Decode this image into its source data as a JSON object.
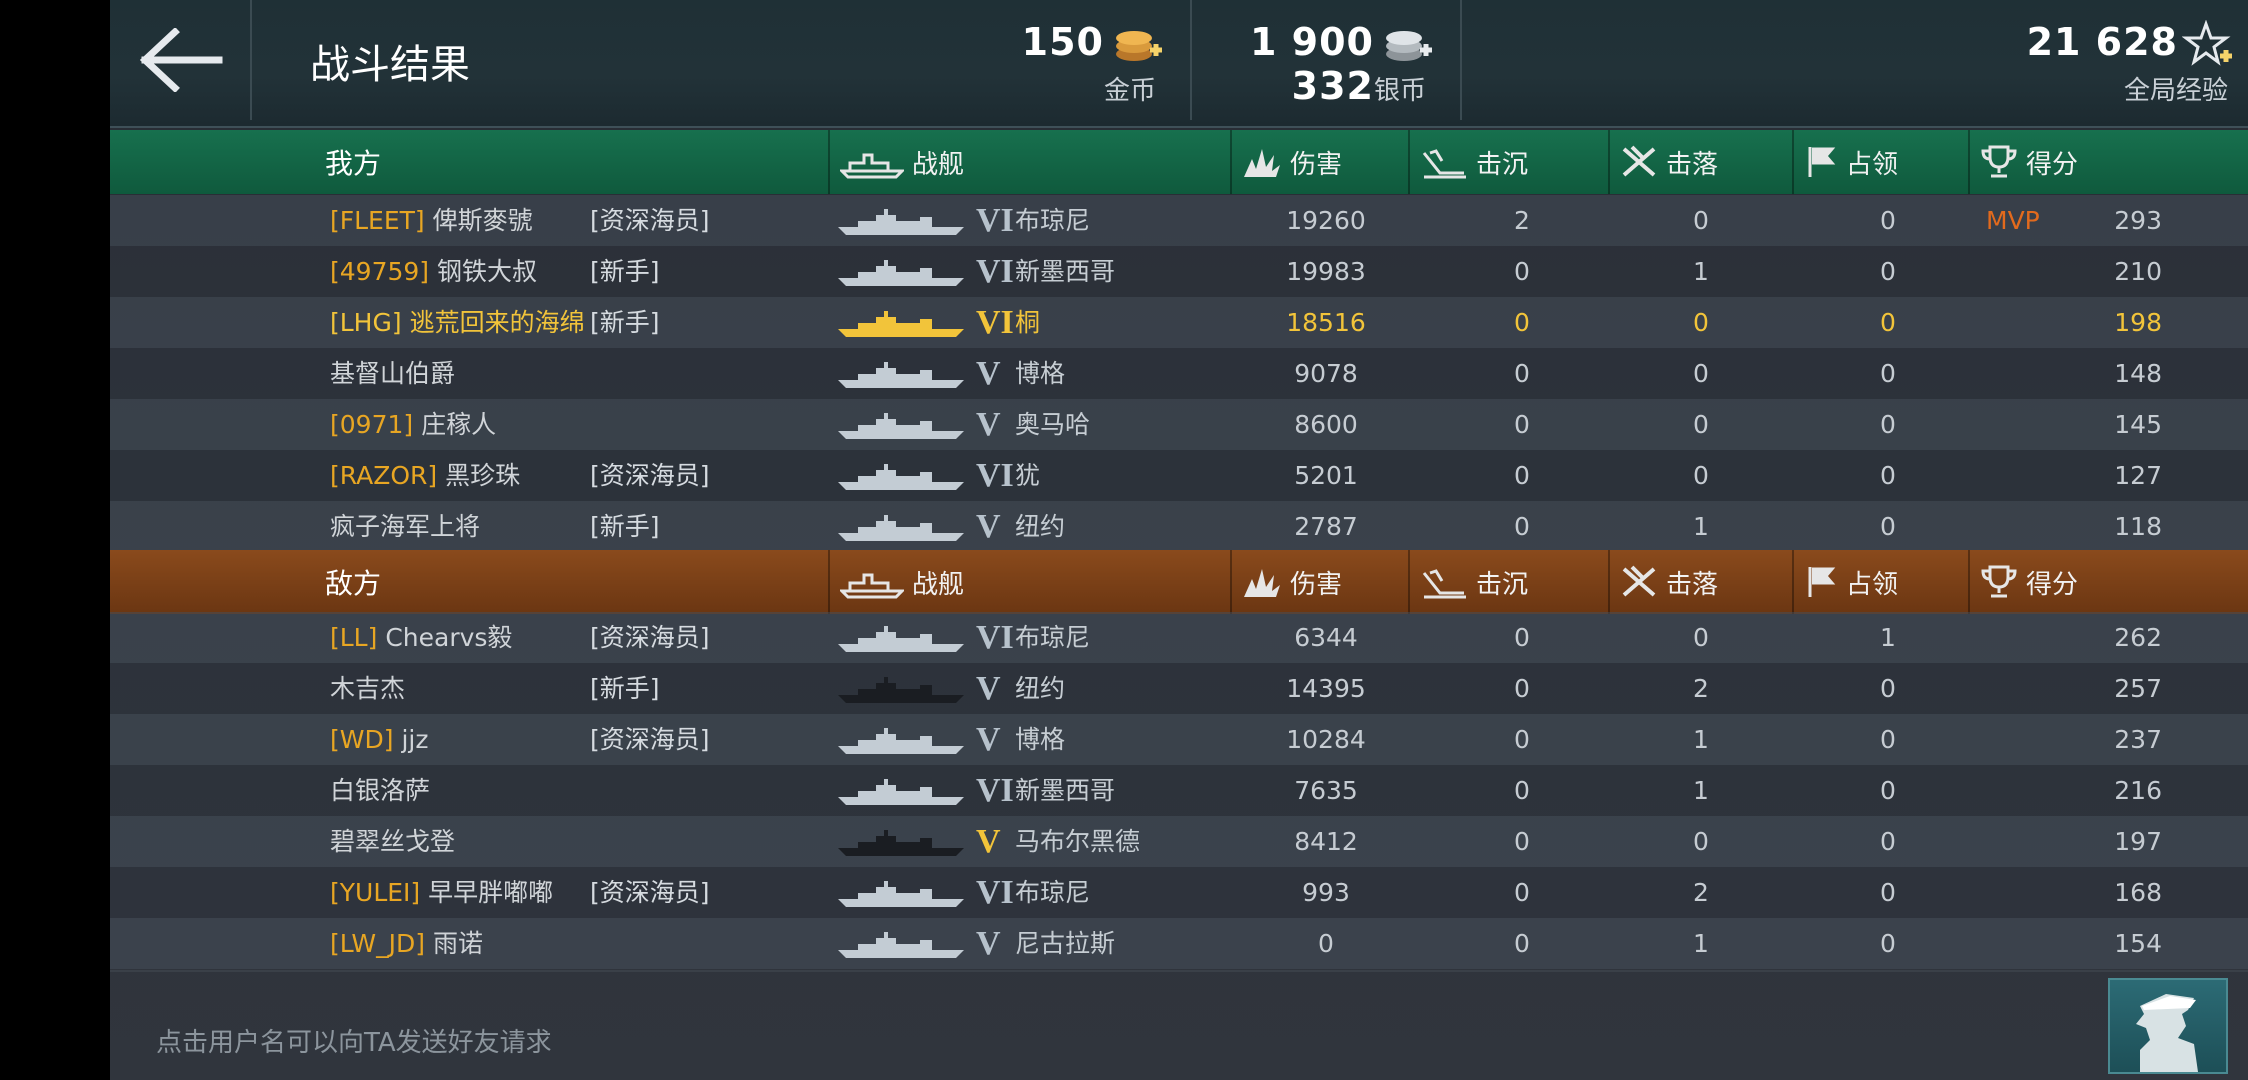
{
  "header": {
    "title": "战斗结果",
    "gold": {
      "amount": "150",
      "label": "金币",
      "icon": "gold-coins-icon"
    },
    "silver": {
      "amount": "1 900 332",
      "label": "银币",
      "icon": "silver-coins-icon"
    },
    "exp": {
      "amount": "21 628",
      "label": "全局经验",
      "icon": "star-plus-icon"
    }
  },
  "columns": {
    "ship": "战舰",
    "damage": "伤害",
    "sunk": "击沉",
    "downed": "击落",
    "capture": "占领",
    "score": "得分"
  },
  "our_team": {
    "label": "我方",
    "rows": [
      {
        "tag": "[FLEET]",
        "name": "俾斯麥號",
        "rank": "[资深海员]",
        "tier": "VI",
        "ship": "布琼尼",
        "damage": "19260",
        "sunk": "2",
        "downed": "0",
        "capture": "0",
        "mvp": "MVP",
        "score": "293"
      },
      {
        "tag": "[49759]",
        "name": "钢铁大叔",
        "rank": "[新手]",
        "tier": "VI",
        "ship": "新墨西哥",
        "damage": "19983",
        "sunk": "0",
        "downed": "1",
        "capture": "0",
        "mvp": "",
        "score": "210"
      },
      {
        "tag": "[LHG]",
        "name": "逃荒回来的海绵",
        "rank": "[新手]",
        "tier": "VI",
        "ship": "桐",
        "damage": "18516",
        "sunk": "0",
        "downed": "0",
        "capture": "0",
        "mvp": "",
        "score": "198",
        "me": true
      },
      {
        "tag": "",
        "name": "基督山伯爵",
        "rank": "",
        "tier": "V",
        "ship": "博格",
        "damage": "9078",
        "sunk": "0",
        "downed": "0",
        "capture": "0",
        "mvp": "",
        "score": "148"
      },
      {
        "tag": "[0971]",
        "name": "庄稼人",
        "rank": "",
        "tier": "V",
        "ship": "奥马哈",
        "damage": "8600",
        "sunk": "0",
        "downed": "0",
        "capture": "0",
        "mvp": "",
        "score": "145"
      },
      {
        "tag": "[RAZOR]",
        "name": "黑珍珠",
        "rank": "[资深海员]",
        "tier": "VI",
        "ship": "犹",
        "damage": "5201",
        "sunk": "0",
        "downed": "0",
        "capture": "0",
        "mvp": "",
        "score": "127"
      },
      {
        "tag": "",
        "name": "疯子海军上将",
        "rank": "[新手]",
        "tier": "V",
        "ship": "纽约",
        "damage": "2787",
        "sunk": "0",
        "downed": "1",
        "capture": "0",
        "mvp": "",
        "score": "118"
      }
    ]
  },
  "enemy_team": {
    "label": "敌方",
    "rows": [
      {
        "tag": "[LL]",
        "name": "Chearvs毅",
        "rank": "[资深海员]",
        "tier": "VI",
        "ship": "布琼尼",
        "damage": "6344",
        "sunk": "0",
        "downed": "0",
        "capture": "1",
        "score": "262"
      },
      {
        "tag": "",
        "name": "木吉杰",
        "rank": "[新手]",
        "tier": "V",
        "ship": "纽约",
        "damage": "14395",
        "sunk": "0",
        "downed": "2",
        "capture": "0",
        "score": "257"
      },
      {
        "tag": "[WD]",
        "name": "jjz",
        "rank": "[资深海员]",
        "tier": "V",
        "ship": "博格",
        "damage": "10284",
        "sunk": "0",
        "downed": "1",
        "capture": "0",
        "score": "237"
      },
      {
        "tag": "",
        "name": "白银洛萨",
        "rank": "",
        "tier": "VI",
        "ship": "新墨西哥",
        "damage": "7635",
        "sunk": "0",
        "downed": "1",
        "capture": "0",
        "score": "216"
      },
      {
        "tag": "",
        "name": "碧翠丝戈登",
        "rank": "",
        "tier": "V",
        "ship": "马布尔黑德",
        "damage": "8412",
        "sunk": "0",
        "downed": "0",
        "capture": "0",
        "score": "197",
        "gold_tier": true
      },
      {
        "tag": "[YULEI]",
        "name": "早早胖嘟嘟",
        "rank": "[资深海员]",
        "tier": "VI",
        "ship": "布琼尼",
        "damage": "993",
        "sunk": "0",
        "downed": "2",
        "capture": "0",
        "score": "168"
      },
      {
        "tag": "[LW_JD]",
        "name": "雨诺",
        "rank": "",
        "tier": "V",
        "ship": "尼古拉斯",
        "damage": "0",
        "sunk": "0",
        "downed": "1",
        "capture": "0",
        "score": "154"
      }
    ]
  },
  "footer": {
    "hint": "点击用户名可以向TA发送好友请求",
    "profile_icon": "captain-profile-icon"
  },
  "colors": {
    "our_header": "#17704e",
    "enemy_header": "#8a4a1c",
    "highlight": "#f2c43a",
    "clan_tag": "#e8a623",
    "mvp": "#e26a1d"
  }
}
